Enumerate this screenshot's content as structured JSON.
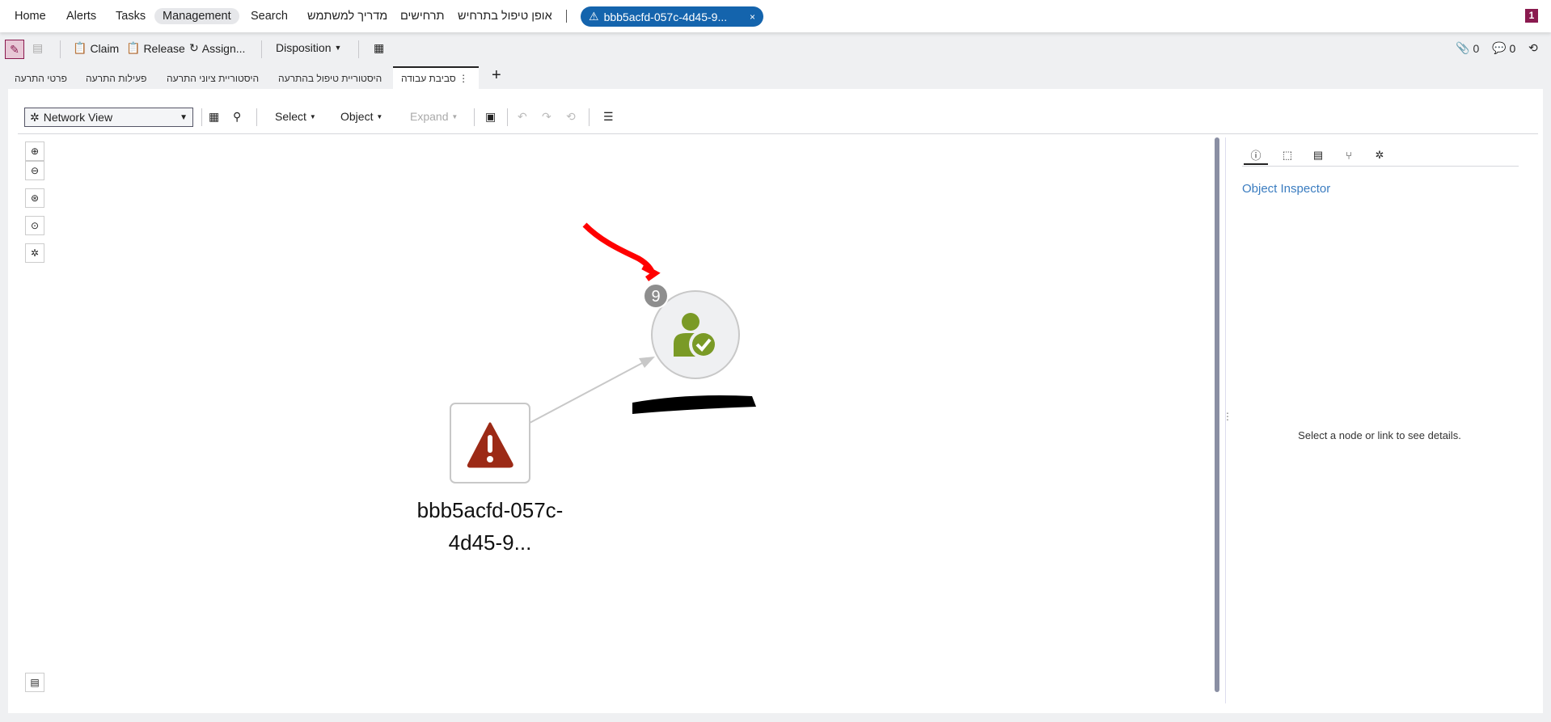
{
  "topnav": {
    "items": [
      "Home",
      "Alerts",
      "Tasks",
      "Management",
      "Search",
      "מדריך למשתמש",
      "תרחישים",
      "אופן טיפול בתרחיש"
    ],
    "active": "Management",
    "open_alert_tab": "bbb5acfd-057c-4d45-9...",
    "close": "×",
    "user_badge": "1"
  },
  "toolbar": {
    "claim": "Claim",
    "release": "Release",
    "assign": "Assign...",
    "disposition": "Disposition",
    "attachments_count": "0",
    "comments_count": "0"
  },
  "tabs": {
    "items": [
      "פרטי התרעה",
      "פעילות התרעה",
      "היסטוריית ציוני התרעה",
      "היסטוריית טיפול בהתרעה",
      "סביבת עבודה"
    ],
    "active": "סביבת עבודה",
    "add": "+"
  },
  "network": {
    "view": "Network View",
    "select": "Select",
    "object": "Object",
    "expand": "Expand"
  },
  "graph": {
    "alert_node_label_line1": "bbb5acfd-057c-",
    "alert_node_label_line2": "4d45-9...",
    "entity_badge_count": "9",
    "colors": {
      "alert": "#9c2a16",
      "entity": "#7a9a26"
    }
  },
  "inspector": {
    "title": "Object Inspector",
    "empty_prefix": "Select a node or ",
    "empty_link": "link",
    "empty_suffix": " to see details."
  }
}
